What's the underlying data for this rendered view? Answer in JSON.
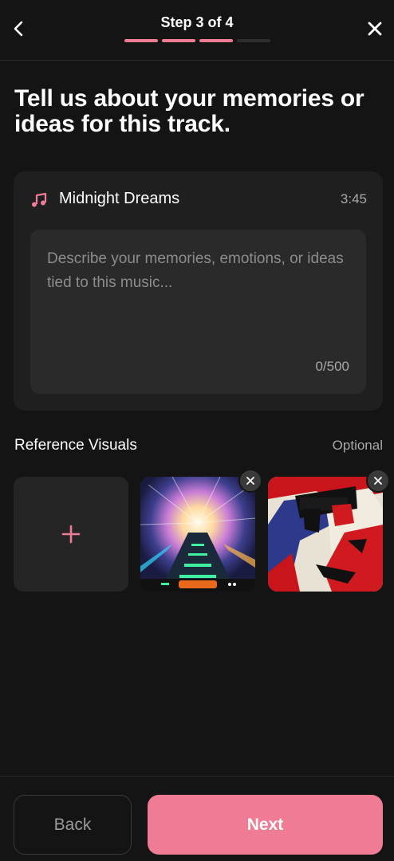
{
  "header": {
    "step_label": "Step 3 of 4",
    "progress": {
      "current": 3,
      "total": 4
    },
    "back_icon": "chevron-left-icon",
    "close_icon": "close-icon"
  },
  "headline": "Tell us about your memories or ideas for this track.",
  "track": {
    "icon": "music-note-icon",
    "name": "Midnight Dreams",
    "duration": "3:45"
  },
  "memories_input": {
    "value": "",
    "placeholder": "Describe your memories, emotions, or ideas tied to this music...",
    "counter": "0/500"
  },
  "reference_visuals": {
    "title": "Reference Visuals",
    "optional_label": "Optional",
    "add_icon": "plus-icon",
    "images": [
      {
        "id": "synthwave-road",
        "remove_icon": "close-icon"
      },
      {
        "id": "pop-art-portrait",
        "remove_icon": "close-icon"
      }
    ]
  },
  "footer": {
    "back_label": "Back",
    "next_label": "Next"
  },
  "colors": {
    "accent": "#f07b95",
    "background": "#141414",
    "card": "#1f1f1f",
    "input": "#2a2a2a"
  }
}
